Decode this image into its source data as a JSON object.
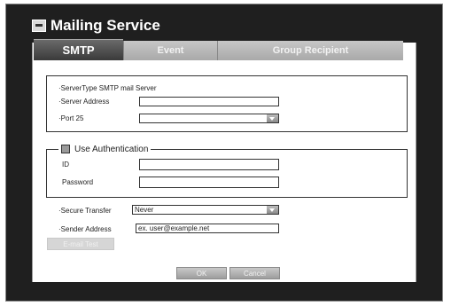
{
  "window": {
    "title": "Mailing Service",
    "icon": "mail-window-icon"
  },
  "tabs": [
    {
      "label": "SMTP",
      "active": true
    },
    {
      "label": "Event",
      "active": false
    },
    {
      "label": "Group Recipient",
      "active": false
    }
  ],
  "server": {
    "server_type": "·ServerType  SMTP mail Server",
    "server_address_label": "·Server Address",
    "server_address_value": "",
    "port_label": "·Port  25",
    "port_value": ""
  },
  "auth": {
    "use_auth_label": "Use Authentication",
    "id_label": "ID",
    "id_value": "",
    "password_label": "Password",
    "password_value": ""
  },
  "transfer": {
    "secure_transfer_label": "·Secure Transfer",
    "secure_transfer_value": "Never",
    "sender_address_label": "·Sender Address",
    "sender_address_value": "ex. user@example.net"
  },
  "buttons": {
    "email_test": "E-mail Test",
    "ok": "OK",
    "cancel": "Cancel"
  },
  "colors": {
    "frame": "#1f1f1f",
    "tab_active": "#4f4f4f",
    "tab_inactive": "#b8b8b8"
  }
}
